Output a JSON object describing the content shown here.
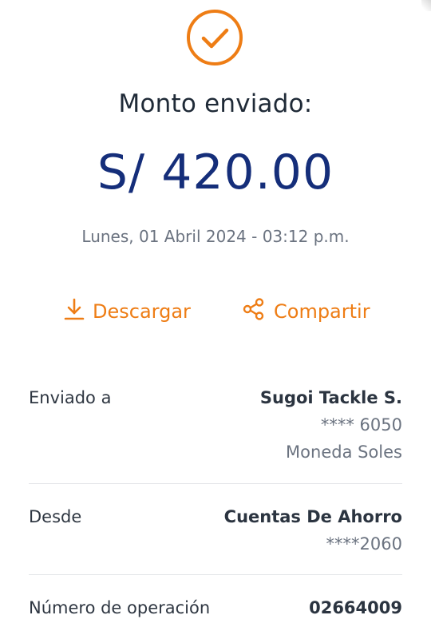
{
  "status": {
    "icon": "check-circle-icon",
    "accent": "#ee7d15"
  },
  "title": "Monto enviado:",
  "amount": "S/ 420.00",
  "datetime": "Lunes, 01 Abril 2024 - 03:12 p.m.",
  "actions": {
    "download": {
      "label": "Descargar",
      "icon": "download-icon"
    },
    "share": {
      "label": "Compartir",
      "icon": "share-icon"
    }
  },
  "details": {
    "sent_to": {
      "label": "Enviado a",
      "name": "Sugoi Tackle S.",
      "account": "**** 6050",
      "currency": "Moneda Soles"
    },
    "from": {
      "label": "Desde",
      "name": "Cuentas De Ahorro",
      "account": "****2060"
    },
    "operation": {
      "label": "Número de operación",
      "value": "02664009"
    }
  },
  "colors": {
    "amount": "#152e7a",
    "accent": "#ee7d15",
    "muted": "#6b7380"
  }
}
